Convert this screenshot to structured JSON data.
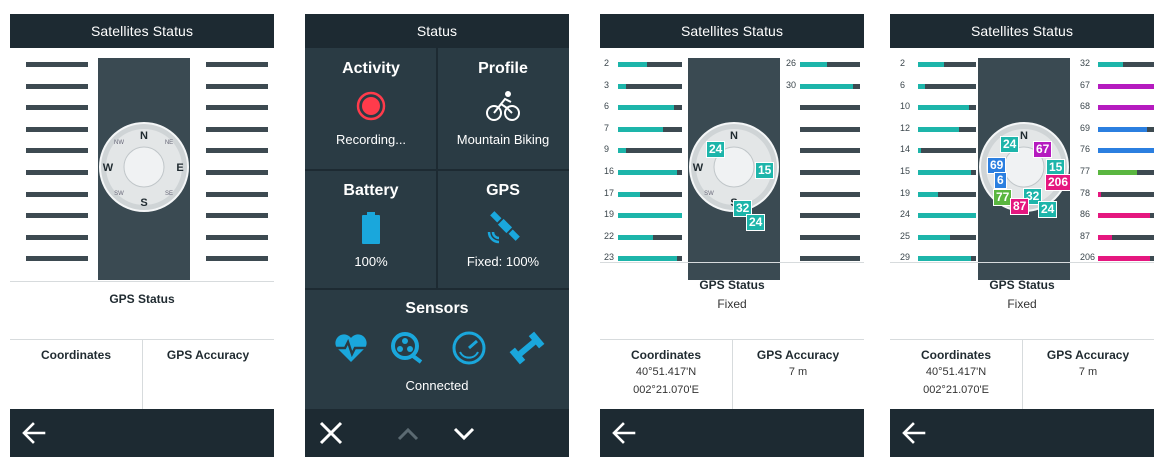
{
  "screens": [
    {
      "title": "Satellites Status",
      "gps_status_label": "GPS Status",
      "gps_status_value": "",
      "coordinates_label": "Coordinates",
      "coordinates_lat": "",
      "coordinates_lon": "",
      "accuracy_label": "GPS Accuracy",
      "accuracy_value": ""
    },
    {
      "title": "Status",
      "activity_label": "Activity",
      "activity_value": "Recording...",
      "profile_label": "Profile",
      "profile_value": "Mountain Biking",
      "battery_label": "Battery",
      "battery_value": "100%",
      "gps_label": "GPS",
      "gps_value": "Fixed: 100%",
      "sensors_label": "Sensors",
      "sensors_value": "Connected",
      "icons": [
        "record-icon",
        "bike-icon",
        "battery-icon",
        "satellite-icon",
        "heart-rate-icon",
        "cadence-icon",
        "speed-icon",
        "power-icon",
        "close-icon",
        "chevron-up-icon",
        "chevron-down-icon"
      ]
    },
    {
      "title": "Satellites Status",
      "gps_status_label": "GPS Status",
      "gps_status_value": "Fixed",
      "coordinates_label": "Coordinates",
      "coordinates_lat": "40°51.417'N",
      "coordinates_lon": "002°21.070'E",
      "accuracy_label": "GPS Accuracy",
      "accuracy_value": "7 m",
      "left_sats": [
        {
          "id": "2",
          "level": 0.45
        },
        {
          "id": "3",
          "level": 0.12
        },
        {
          "id": "6",
          "level": 0.88
        },
        {
          "id": "7",
          "level": 0.7
        },
        {
          "id": "9",
          "level": 0.12
        },
        {
          "id": "16",
          "level": 0.92
        },
        {
          "id": "17",
          "level": 0.35
        },
        {
          "id": "19",
          "level": 1.0
        },
        {
          "id": "22",
          "level": 0.55
        },
        {
          "id": "23",
          "level": 0.92
        }
      ],
      "right_sats": [
        {
          "id": "26",
          "level": 0.45
        },
        {
          "id": "30",
          "level": 0.88
        }
      ],
      "sky_tags": [
        {
          "id": "24",
          "color": "#1db5aa"
        },
        {
          "id": "15",
          "color": "#1db5aa"
        },
        {
          "id": "32",
          "color": "#1db5aa"
        },
        {
          "id": "24",
          "color": "#1db5aa"
        }
      ]
    },
    {
      "title": "Satellites Status",
      "gps_status_label": "GPS Status",
      "gps_status_value": "Fixed",
      "coordinates_label": "Coordinates",
      "coordinates_lat": "40°51.417'N",
      "coordinates_lon": "002°21.070'E",
      "accuracy_label": "GPS Accuracy",
      "accuracy_value": "7 m",
      "left_sats": [
        {
          "id": "2",
          "level": 0.45
        },
        {
          "id": "6",
          "level": 0.12
        },
        {
          "id": "10",
          "level": 0.88
        },
        {
          "id": "12",
          "level": 0.7
        },
        {
          "id": "14",
          "level": 0.05
        },
        {
          "id": "15",
          "level": 0.92
        },
        {
          "id": "19",
          "level": 0.35
        },
        {
          "id": "24",
          "level": 1.0
        },
        {
          "id": "25",
          "level": 0.55
        },
        {
          "id": "29",
          "level": 0.92
        }
      ],
      "right_sats": [
        {
          "id": "32",
          "level": 0.45,
          "color": "#1db5aa"
        },
        {
          "id": "67",
          "level": 1.0,
          "color": "#b51bbf"
        },
        {
          "id": "68",
          "level": 1.0,
          "color": "#b51bbf"
        },
        {
          "id": "69",
          "level": 0.88,
          "color": "#2b7fe0"
        },
        {
          "id": "76",
          "level": 1.0,
          "color": "#2b7fe0"
        },
        {
          "id": "77",
          "level": 0.7,
          "color": "#5ab640"
        },
        {
          "id": "78",
          "level": 0.05,
          "color": "#e5177f"
        },
        {
          "id": "86",
          "level": 0.92,
          "color": "#e5177f"
        },
        {
          "id": "87",
          "level": 0.25,
          "color": "#e5177f"
        },
        {
          "id": "206",
          "level": 0.92,
          "color": "#e5177f"
        }
      ],
      "sky_tags": [
        {
          "id": "24",
          "color": "#1db5aa"
        },
        {
          "id": "67",
          "color": "#b51bbf"
        },
        {
          "id": "15",
          "color": "#1db5aa"
        },
        {
          "id": "69",
          "color": "#2b7fe0"
        },
        {
          "id": "206",
          "color": "#e5177f"
        },
        {
          "id": "6",
          "color": "#2b7fe0"
        },
        {
          "id": "77",
          "color": "#5ab640"
        },
        {
          "id": "32",
          "color": "#1db5aa"
        },
        {
          "id": "87",
          "color": "#e5177f"
        },
        {
          "id": "24",
          "color": "#1db5aa"
        }
      ]
    }
  ],
  "colors": {
    "teal": "#1db5aa",
    "dark_bar": "#3d4a51",
    "title_bg": "#1d2a32",
    "status_bg": "#2a3b44",
    "record_red": "#ff3b4b",
    "icon_blue": "#1aa7dc"
  },
  "compass_letters": {
    "n": "N",
    "s": "S",
    "w": "W",
    "e": "E",
    "nw": "NW",
    "ne": "NE",
    "sw": "SW",
    "se": "SE"
  }
}
